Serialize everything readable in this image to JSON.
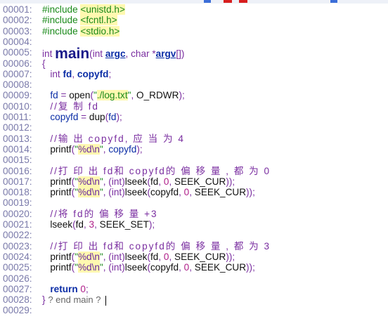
{
  "editor": {
    "lines": [
      {
        "n": "00001:",
        "parts": [
          [
            "pp",
            "#include "
          ],
          [
            "pp hl",
            "<unistd.h>"
          ]
        ]
      },
      {
        "n": "00002:",
        "parts": [
          [
            "pp",
            "#include "
          ],
          [
            "pp hl",
            "<fcntl.h>"
          ]
        ]
      },
      {
        "n": "00003:",
        "parts": [
          [
            "pp",
            "#include "
          ],
          [
            "pp hl",
            "<stdio.h>"
          ]
        ]
      },
      {
        "n": "00004:",
        "parts": []
      },
      {
        "n": "00005:",
        "parts": [
          [
            "ty",
            "int "
          ],
          [
            "fn-big",
            "main"
          ],
          [
            "punc",
            "("
          ],
          [
            "ty",
            "int "
          ],
          [
            "param",
            "argc"
          ],
          [
            "punc",
            ", "
          ],
          [
            "ty",
            "char "
          ],
          [
            "punc",
            "*"
          ],
          [
            "param",
            "argv"
          ],
          [
            "punc",
            "[])"
          ]
        ]
      },
      {
        "n": "00006:",
        "parts": [
          [
            "punc",
            "{"
          ]
        ]
      },
      {
        "n": "00007:",
        "parts": [
          [
            "plain",
            "   "
          ],
          [
            "ty",
            "int "
          ],
          [
            "kw",
            "fd"
          ],
          [
            "punc",
            ", "
          ],
          [
            "kw",
            "copyfd"
          ],
          [
            "punc",
            ";"
          ]
        ]
      },
      {
        "n": "00008:",
        "parts": []
      },
      {
        "n": "00009:",
        "parts": [
          [
            "plain",
            "   "
          ],
          [
            "var",
            "fd"
          ],
          [
            "op",
            " = "
          ],
          [
            "plain",
            "open"
          ],
          [
            "punc",
            "("
          ],
          [
            "str",
            "\""
          ],
          [
            "str str-hl",
            "./log.txt"
          ],
          [
            "str",
            "\""
          ],
          [
            "punc",
            ", "
          ],
          [
            "plain",
            "O_RDWR"
          ],
          [
            "punc",
            ");"
          ]
        ]
      },
      {
        "n": "00010:",
        "parts": [
          [
            "plain",
            "   "
          ],
          [
            "cm",
            "//复 制 fd"
          ]
        ]
      },
      {
        "n": "00011:",
        "parts": [
          [
            "plain",
            "   "
          ],
          [
            "var",
            "copyfd"
          ],
          [
            "op",
            " = "
          ],
          [
            "plain",
            "dup"
          ],
          [
            "punc",
            "("
          ],
          [
            "var",
            "fd"
          ],
          [
            "punc",
            ");"
          ]
        ]
      },
      {
        "n": "00012:",
        "parts": []
      },
      {
        "n": "00013:",
        "parts": [
          [
            "plain",
            "   "
          ],
          [
            "cm",
            "//输 出 copyfd, 应 当 为 4"
          ]
        ]
      },
      {
        "n": "00014:",
        "parts": [
          [
            "plain",
            "   "
          ],
          [
            "plain",
            "printf"
          ],
          [
            "punc",
            "("
          ],
          [
            "str",
            "\""
          ],
          [
            "esc str-hl",
            "%d\\n"
          ],
          [
            "str",
            "\""
          ],
          [
            "punc",
            ", "
          ],
          [
            "var",
            "copyfd"
          ],
          [
            "punc",
            ");"
          ]
        ]
      },
      {
        "n": "00015:",
        "parts": []
      },
      {
        "n": "00016:",
        "parts": [
          [
            "plain",
            "   "
          ],
          [
            "cm",
            "//打 印 出 fd和 copyfd的 偏 移 量 , 都 为 0"
          ]
        ]
      },
      {
        "n": "00017:",
        "parts": [
          [
            "plain",
            "   "
          ],
          [
            "plain",
            "printf"
          ],
          [
            "punc",
            "("
          ],
          [
            "str",
            "\""
          ],
          [
            "esc str-hl",
            "%d\\n"
          ],
          [
            "str",
            "\""
          ],
          [
            "punc",
            ", ("
          ],
          [
            "ty",
            "int"
          ],
          [
            "punc",
            ")"
          ],
          [
            "plain",
            "lseek"
          ],
          [
            "punc",
            "("
          ],
          [
            "plain",
            "fd"
          ],
          [
            "punc",
            ", "
          ],
          [
            "num",
            "0"
          ],
          [
            "punc",
            ", "
          ],
          [
            "plain",
            "SEEK_CUR"
          ],
          [
            "punc",
            "));"
          ]
        ]
      },
      {
        "n": "00018:",
        "parts": [
          [
            "plain",
            "   "
          ],
          [
            "plain",
            "printf"
          ],
          [
            "punc",
            "("
          ],
          [
            "str",
            "\""
          ],
          [
            "esc str-hl",
            "%d\\n"
          ],
          [
            "str",
            "\""
          ],
          [
            "punc",
            ", ("
          ],
          [
            "ty",
            "int"
          ],
          [
            "punc",
            ")"
          ],
          [
            "plain",
            "lseek"
          ],
          [
            "punc",
            "("
          ],
          [
            "plain",
            "copyfd"
          ],
          [
            "punc",
            ", "
          ],
          [
            "num",
            "0"
          ],
          [
            "punc",
            ", "
          ],
          [
            "plain",
            "SEEK_CUR"
          ],
          [
            "punc",
            "));"
          ]
        ]
      },
      {
        "n": "00019:",
        "parts": []
      },
      {
        "n": "00020:",
        "parts": [
          [
            "plain",
            "   "
          ],
          [
            "cm",
            "//将 fd的 偏 移 量 +3"
          ]
        ]
      },
      {
        "n": "00021:",
        "parts": [
          [
            "plain",
            "   "
          ],
          [
            "plain",
            "lseek"
          ],
          [
            "punc",
            "("
          ],
          [
            "plain",
            "fd"
          ],
          [
            "punc",
            ", "
          ],
          [
            "num",
            "3"
          ],
          [
            "punc",
            ", "
          ],
          [
            "plain",
            "SEEK_SET"
          ],
          [
            "punc",
            ");"
          ]
        ]
      },
      {
        "n": "00022:",
        "parts": []
      },
      {
        "n": "00023:",
        "parts": [
          [
            "plain",
            "   "
          ],
          [
            "cm",
            "//打 印 出 fd和 copyfd的 偏 移 量 , 都 为 3"
          ]
        ]
      },
      {
        "n": "00024:",
        "parts": [
          [
            "plain",
            "   "
          ],
          [
            "plain",
            "printf"
          ],
          [
            "punc",
            "("
          ],
          [
            "str",
            "\""
          ],
          [
            "esc str-hl",
            "%d\\n"
          ],
          [
            "str",
            "\""
          ],
          [
            "punc",
            ", ("
          ],
          [
            "ty",
            "int"
          ],
          [
            "punc",
            ")"
          ],
          [
            "plain",
            "lseek"
          ],
          [
            "punc",
            "("
          ],
          [
            "plain",
            "fd"
          ],
          [
            "punc",
            ", "
          ],
          [
            "num",
            "0"
          ],
          [
            "punc",
            ", "
          ],
          [
            "plain",
            "SEEK_CUR"
          ],
          [
            "punc",
            "));"
          ]
        ]
      },
      {
        "n": "00025:",
        "parts": [
          [
            "plain",
            "   "
          ],
          [
            "plain",
            "printf"
          ],
          [
            "punc",
            "("
          ],
          [
            "str",
            "\""
          ],
          [
            "esc str-hl",
            "%d\\n"
          ],
          [
            "str",
            "\""
          ],
          [
            "punc",
            ", ("
          ],
          [
            "ty",
            "int"
          ],
          [
            "punc",
            ")"
          ],
          [
            "plain",
            "lseek"
          ],
          [
            "punc",
            "("
          ],
          [
            "plain",
            "copyfd"
          ],
          [
            "punc",
            ", "
          ],
          [
            "num",
            "0"
          ],
          [
            "punc",
            ", "
          ],
          [
            "plain",
            "SEEK_CUR"
          ],
          [
            "punc",
            "));"
          ]
        ]
      },
      {
        "n": "00026:",
        "parts": []
      },
      {
        "n": "00027:",
        "parts": [
          [
            "plain",
            "   "
          ],
          [
            "kw",
            "return "
          ],
          [
            "num",
            "0"
          ],
          [
            "punc",
            ";"
          ]
        ]
      },
      {
        "n": "00028:",
        "parts": [
          [
            "punc",
            "} "
          ],
          [
            "endmain",
            "? end main ?"
          ]
        ],
        "caret": true
      },
      {
        "n": "00029:",
        "parts": []
      }
    ]
  }
}
